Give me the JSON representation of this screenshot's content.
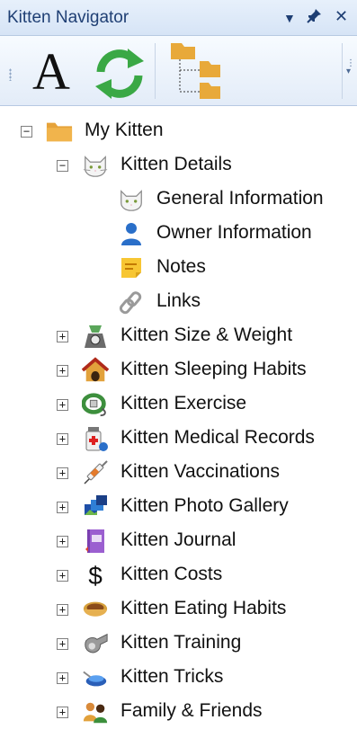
{
  "panel": {
    "title": "Kitten Navigator",
    "controls": {
      "dropdown": "▼",
      "pin": "📌",
      "close": "✕"
    }
  },
  "toolbar": {
    "font_button_label": "A",
    "refresh_icon": "refresh-icon",
    "folder_tree_icon": "folder-tree-icon"
  },
  "tree": {
    "root": {
      "label": "My Kitten",
      "icon": "folder-icon",
      "expanded": true
    },
    "kitten_details": {
      "label": "Kitten Details",
      "icon": "cat-face-icon",
      "expanded": true,
      "children": [
        {
          "label": "General Information",
          "icon": "cat-face-icon"
        },
        {
          "label": "Owner Information",
          "icon": "person-icon"
        },
        {
          "label": "Notes",
          "icon": "note-icon"
        },
        {
          "label": "Links",
          "icon": "chain-link-icon"
        }
      ]
    },
    "sections": [
      {
        "label": "Kitten Size & Weight",
        "icon": "scale-icon"
      },
      {
        "label": "Kitten Sleeping Habits",
        "icon": "cat-house-icon"
      },
      {
        "label": "Kitten Exercise",
        "icon": "leash-icon"
      },
      {
        "label": "Kitten Medical Records",
        "icon": "medical-bottle-icon"
      },
      {
        "label": "Kitten Vaccinations",
        "icon": "syringe-icon"
      },
      {
        "label": "Kitten Photo Gallery",
        "icon": "photos-icon"
      },
      {
        "label": "Kitten Journal",
        "icon": "journal-icon"
      },
      {
        "label": "Kitten Costs",
        "icon": "dollar-icon"
      },
      {
        "label": "Kitten Eating Habits",
        "icon": "food-bowl-icon"
      },
      {
        "label": "Kitten Training",
        "icon": "whistle-icon"
      },
      {
        "label": "Kitten Tricks",
        "icon": "clicker-icon"
      },
      {
        "label": "Family & Friends",
        "icon": "people-icon"
      }
    ]
  }
}
